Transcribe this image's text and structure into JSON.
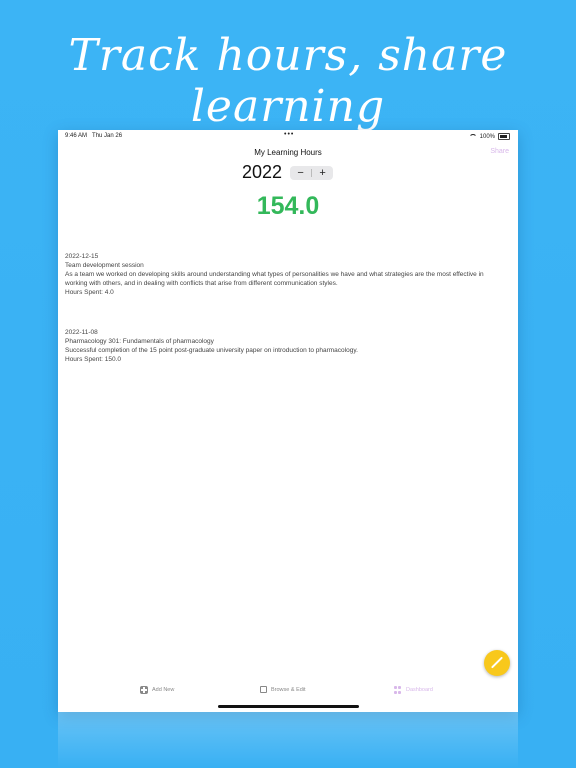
{
  "promo": {
    "headline": "Track hours, share learning"
  },
  "status_bar": {
    "time": "9:46 AM",
    "date": "Thu Jan 26",
    "battery": "100%"
  },
  "nav": {
    "title": "My Learning Hours",
    "share_label": "Share"
  },
  "year_selector": {
    "year": "2022",
    "minus": "−",
    "plus": "+"
  },
  "total_hours": "154.0",
  "entries": [
    {
      "date": "2022-12-15",
      "title": "Team development session",
      "description": "As a team we worked on developing skills around understanding what types of personalities we have and what strategies are the most effective in working with others, and in dealing with conflicts that arise from different communication styles.",
      "hours": "Hours Spent: 4.0"
    },
    {
      "date": "2022-11-08",
      "title": "Pharmacology 301:  Fundamentals of pharmacology",
      "description": "Successful completion of the 15 point post-graduate university paper on introduction to pharmacology.",
      "hours": "Hours Spent: 150.0"
    }
  ],
  "tabs": [
    {
      "label": "Add New",
      "icon": "plus-square-icon"
    },
    {
      "label": "Browse & Edit",
      "icon": "edit-icon"
    },
    {
      "label": "Dashboard",
      "icon": "grid-icon"
    }
  ],
  "colors": {
    "background": "#3cb4f5",
    "total": "#33b85a",
    "fab": "#f8c81c",
    "accent": "#d8b8ea"
  }
}
